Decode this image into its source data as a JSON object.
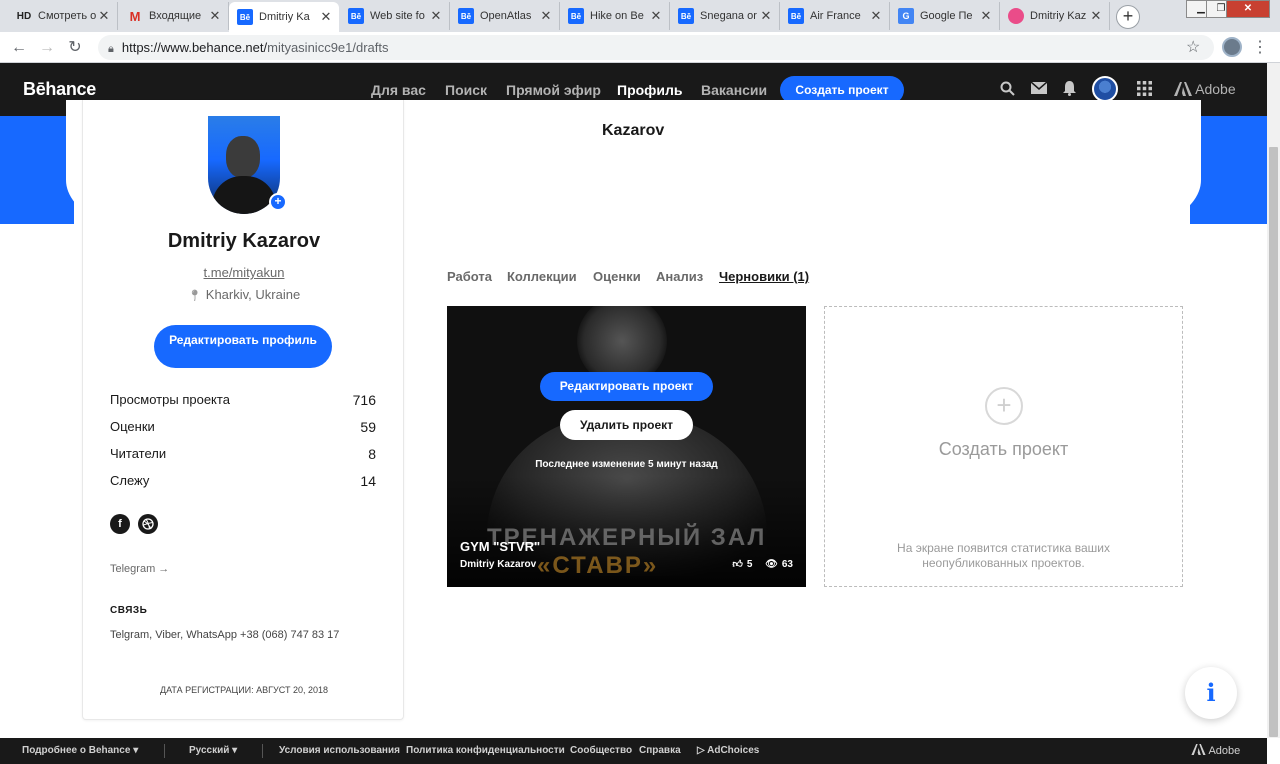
{
  "browser": {
    "tabs": [
      {
        "label": "Смотреть о",
        "icon": "hd-icon",
        "fav": "HD"
      },
      {
        "label": "Входящие",
        "icon": "gmail-icon",
        "fav": "M"
      },
      {
        "label": "Dmitriy Ka",
        "icon": "behance-icon",
        "fav": "Bē"
      },
      {
        "label": "Web site fo",
        "icon": "behance-icon",
        "fav": "Bē"
      },
      {
        "label": "OpenAtlas",
        "icon": "behance-icon",
        "fav": "Bē"
      },
      {
        "label": "Hike on Be",
        "icon": "behance-icon",
        "fav": "Bē"
      },
      {
        "label": "Snegana or",
        "icon": "behance-icon",
        "fav": "Bē"
      },
      {
        "label": "Air France",
        "icon": "behance-icon",
        "fav": "Bē"
      },
      {
        "label": "Google Пе",
        "icon": "google-translate-icon",
        "fav": "G"
      },
      {
        "label": "Dmitriy Kaz",
        "icon": "dribbble-icon",
        "fav": ""
      }
    ],
    "url_host": "https://www.behance.net/",
    "url_path": "mityasinicc9e1/drafts"
  },
  "header": {
    "logo": "Bēhance",
    "nav": [
      "Для вас",
      "Поиск",
      "Прямой эфир",
      "Профиль",
      "Вакансии"
    ],
    "create_label": "Создать проект",
    "adobe": "Adobe"
  },
  "page_title": "Kazarov",
  "profile": {
    "name": "Dmitriy Kazarov",
    "link": "t.me/mityakun",
    "location": "Kharkiv, Ukraine",
    "edit_label": "Редактировать профиль",
    "stats": [
      {
        "label": "Просмотры проекта",
        "value": "716"
      },
      {
        "label": "Оценки",
        "value": "59"
      },
      {
        "label": "Читатели",
        "value": "8"
      },
      {
        "label": "Слежу",
        "value": "14"
      }
    ],
    "telegram": "Telegram →",
    "contact_heading": "СВЯЗЬ",
    "contact_text": "Telgram, Viber, WhatsApp +38 (068) 747 83 17",
    "member_since": "ДАТА РЕГИСТРАЦИИ: АВГУСТ 20, 2018"
  },
  "tabs": [
    "Работа",
    "Коллекции",
    "Оценки",
    "Анализ",
    "Черновики (1)"
  ],
  "draft": {
    "edit_label": "Редактировать проект",
    "delete_label": "Удалить проект",
    "last_modified": "Последнее изменение 5 минут назад",
    "bg_line1": "ТРЕНАЖЕРНЫЙ ЗАЛ",
    "bg_line2": "«СТАВР»",
    "title": "GYM \"STVR\"",
    "owner": "Dmitriy Kazarov",
    "likes": "5",
    "views": "63"
  },
  "create_card": {
    "label": "Создать проект",
    "hint": "На экране появится статистика ваших неопубликованных проектов."
  },
  "footer": {
    "more": "Подробнее о Behance ▾",
    "lang": "Русский ▾",
    "links": [
      "Условия использования",
      "Политика конфиденциальности",
      "Сообщество",
      "Справка"
    ],
    "adchoices": "AdChoices",
    "adobe": "Adobe"
  },
  "colors": {
    "brand": "#1769ff",
    "header_bg": "#191919"
  }
}
